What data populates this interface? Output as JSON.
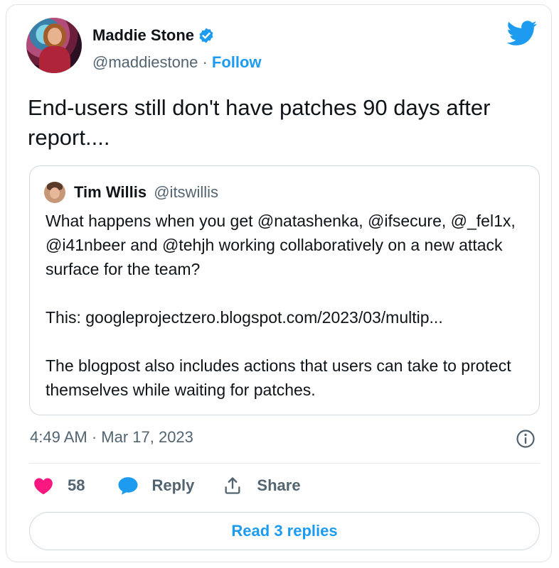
{
  "author": {
    "name": "Maddie Stone",
    "handle": "@maddiestone",
    "separator": "·",
    "follow_label": "Follow",
    "avatar": "avatar",
    "verified_icon": "verified-badge-icon"
  },
  "brand": {
    "icon": "twitter-bird-icon",
    "color": "#1d9bf0"
  },
  "tweet": {
    "text": "End-users still don't have patches 90 days after report...."
  },
  "quoted": {
    "name": "Tim Willis",
    "handle": "@itswillis",
    "paragraphs": [
      "What happens when you get @natashenka, @ifsecure, @_fel1x, @i41nbeer and @tehjh working collaboratively on a new attack surface for the team?",
      "This: googleprojectzero.blogspot.com/2023/03/multip...",
      "The blogpost also includes actions that users can take to protect themselves while waiting for patches."
    ]
  },
  "timestamp": "4:49 AM · Mar 17, 2023",
  "actions": {
    "like_count": "58",
    "reply_label": "Reply",
    "share_label": "Share",
    "like_color": "#f91880",
    "reply_color": "#1d9bf0"
  },
  "read_replies_label": "Read 3 replies"
}
